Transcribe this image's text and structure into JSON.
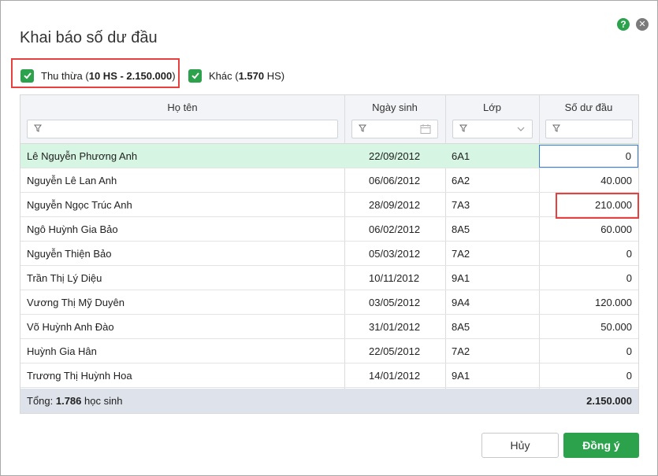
{
  "dialog": {
    "title": "Khai báo số dư đầu",
    "help_icon": "question-circle-icon",
    "close_icon": "close-circle-icon"
  },
  "options": [
    {
      "label_prefix": "Thu thừa (",
      "label_bold": "10 HS - 2.150.000",
      "label_suffix": ")",
      "checked": true
    },
    {
      "label_prefix": "Khác (",
      "label_bold": "1.570",
      "label_suffix": " HS)",
      "checked": true
    }
  ],
  "table": {
    "columns": [
      "Họ tên",
      "Ngày sinh",
      "Lớp",
      "Số dư đầu"
    ],
    "rows": [
      {
        "name": "Lê Nguyễn Phương Anh",
        "dob": "22/09/2012",
        "class": "6A1",
        "balance": "0",
        "selected": true,
        "editing": true
      },
      {
        "name": "Nguyễn Lê  Lan Anh",
        "dob": "06/06/2012",
        "class": "6A2",
        "balance": "40.000"
      },
      {
        "name": "Nguyễn Ngọc Trúc Anh",
        "dob": "28/09/2012",
        "class": "7A3",
        "balance": "210.000",
        "highlighted": true
      },
      {
        "name": "Ngô Huỳnh Gia Bảo",
        "dob": "06/02/2012",
        "class": "8A5",
        "balance": "60.000"
      },
      {
        "name": "Nguyễn Thiện Bảo",
        "dob": "05/03/2012",
        "class": "7A2",
        "balance": "0"
      },
      {
        "name": "Trần Thị Lý Diệu",
        "dob": "10/11/2012",
        "class": "9A1",
        "balance": "0"
      },
      {
        "name": "Vương Thị Mỹ Duyên",
        "dob": "03/05/2012",
        "class": "9A4",
        "balance": "120.000"
      },
      {
        "name": "Võ Huỳnh Anh Đào",
        "dob": "31/01/2012",
        "class": "8A5",
        "balance": "50.000"
      },
      {
        "name": "Huỳnh Gia Hân",
        "dob": "22/05/2012",
        "class": "7A2",
        "balance": "0"
      },
      {
        "name": "Trương Thị Huỳnh Hoa",
        "dob": "14/01/2012",
        "class": "9A1",
        "balance": "0"
      }
    ],
    "footer": {
      "prefix": "Tổng: ",
      "count": "1.786",
      "suffix": " học sinh",
      "total": "2.150.000"
    }
  },
  "buttons": {
    "cancel": "Hủy",
    "ok": "Đồng ý"
  },
  "colors": {
    "accent": "#2ca24d",
    "highlight": "#e8403e",
    "selected_row": "#d6f5e2",
    "focus_border": "#3b7fd8"
  }
}
